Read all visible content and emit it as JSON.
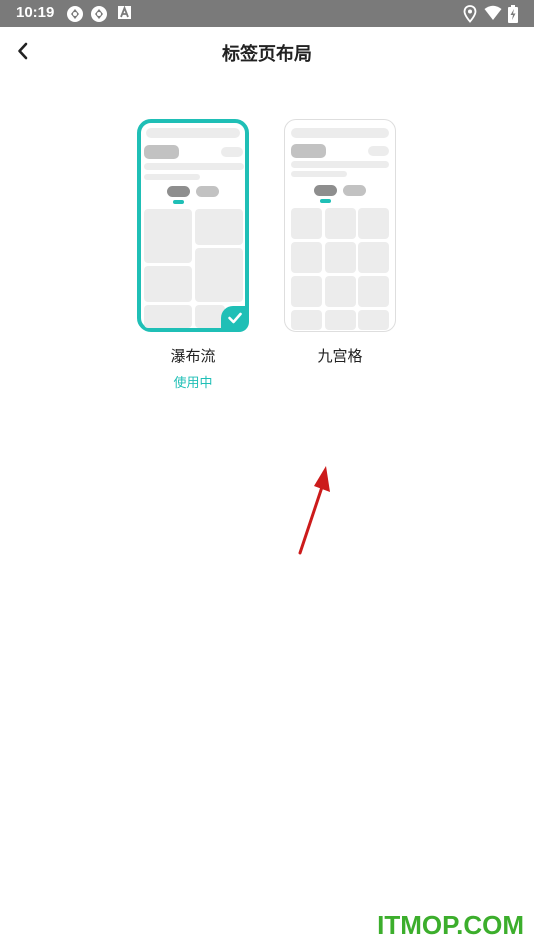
{
  "status_bar": {
    "time": "10:19",
    "left_icons": [
      "sync-icon",
      "sync-icon",
      "font-icon"
    ],
    "right_icons": [
      "location-icon",
      "wifi-icon",
      "battery-charging-icon"
    ]
  },
  "header": {
    "back_icon": "chevron-left-icon",
    "title": "标签页布局"
  },
  "layouts": [
    {
      "label": "瀑布流",
      "status": "使用中",
      "selected": true
    },
    {
      "label": "九宫格",
      "status": "",
      "selected": false
    }
  ],
  "accent_color": "#1fbfb6",
  "watermark": "ITMOP.COM"
}
